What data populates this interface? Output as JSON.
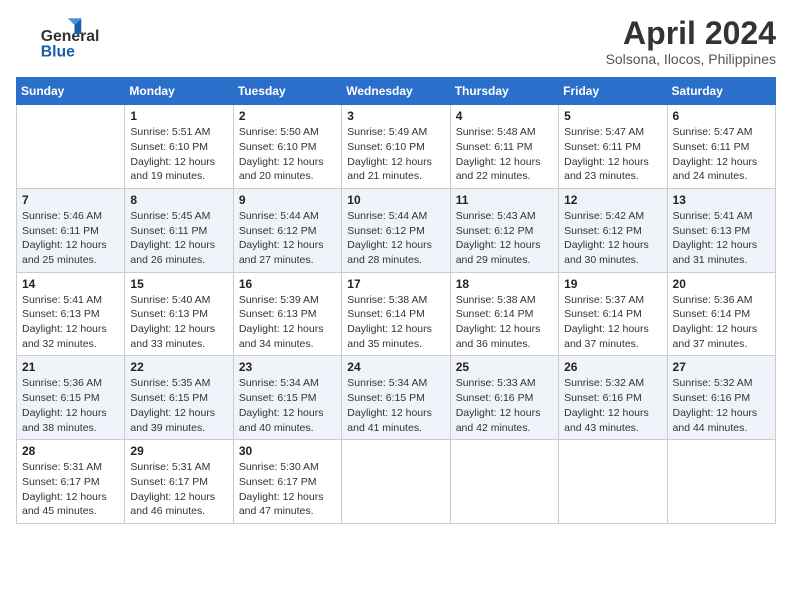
{
  "header": {
    "logo_line1": "General",
    "logo_line2": "Blue",
    "month_year": "April 2024",
    "location": "Solsona, Ilocos, Philippines"
  },
  "days_of_week": [
    "Sunday",
    "Monday",
    "Tuesday",
    "Wednesday",
    "Thursday",
    "Friday",
    "Saturday"
  ],
  "weeks": [
    [
      {
        "day": "",
        "info": ""
      },
      {
        "day": "1",
        "info": "Sunrise: 5:51 AM\nSunset: 6:10 PM\nDaylight: 12 hours\nand 19 minutes."
      },
      {
        "day": "2",
        "info": "Sunrise: 5:50 AM\nSunset: 6:10 PM\nDaylight: 12 hours\nand 20 minutes."
      },
      {
        "day": "3",
        "info": "Sunrise: 5:49 AM\nSunset: 6:10 PM\nDaylight: 12 hours\nand 21 minutes."
      },
      {
        "day": "4",
        "info": "Sunrise: 5:48 AM\nSunset: 6:11 PM\nDaylight: 12 hours\nand 22 minutes."
      },
      {
        "day": "5",
        "info": "Sunrise: 5:47 AM\nSunset: 6:11 PM\nDaylight: 12 hours\nand 23 minutes."
      },
      {
        "day": "6",
        "info": "Sunrise: 5:47 AM\nSunset: 6:11 PM\nDaylight: 12 hours\nand 24 minutes."
      }
    ],
    [
      {
        "day": "7",
        "info": "Sunrise: 5:46 AM\nSunset: 6:11 PM\nDaylight: 12 hours\nand 25 minutes."
      },
      {
        "day": "8",
        "info": "Sunrise: 5:45 AM\nSunset: 6:11 PM\nDaylight: 12 hours\nand 26 minutes."
      },
      {
        "day": "9",
        "info": "Sunrise: 5:44 AM\nSunset: 6:12 PM\nDaylight: 12 hours\nand 27 minutes."
      },
      {
        "day": "10",
        "info": "Sunrise: 5:44 AM\nSunset: 6:12 PM\nDaylight: 12 hours\nand 28 minutes."
      },
      {
        "day": "11",
        "info": "Sunrise: 5:43 AM\nSunset: 6:12 PM\nDaylight: 12 hours\nand 29 minutes."
      },
      {
        "day": "12",
        "info": "Sunrise: 5:42 AM\nSunset: 6:12 PM\nDaylight: 12 hours\nand 30 minutes."
      },
      {
        "day": "13",
        "info": "Sunrise: 5:41 AM\nSunset: 6:13 PM\nDaylight: 12 hours\nand 31 minutes."
      }
    ],
    [
      {
        "day": "14",
        "info": "Sunrise: 5:41 AM\nSunset: 6:13 PM\nDaylight: 12 hours\nand 32 minutes."
      },
      {
        "day": "15",
        "info": "Sunrise: 5:40 AM\nSunset: 6:13 PM\nDaylight: 12 hours\nand 33 minutes."
      },
      {
        "day": "16",
        "info": "Sunrise: 5:39 AM\nSunset: 6:13 PM\nDaylight: 12 hours\nand 34 minutes."
      },
      {
        "day": "17",
        "info": "Sunrise: 5:38 AM\nSunset: 6:14 PM\nDaylight: 12 hours\nand 35 minutes."
      },
      {
        "day": "18",
        "info": "Sunrise: 5:38 AM\nSunset: 6:14 PM\nDaylight: 12 hours\nand 36 minutes."
      },
      {
        "day": "19",
        "info": "Sunrise: 5:37 AM\nSunset: 6:14 PM\nDaylight: 12 hours\nand 37 minutes."
      },
      {
        "day": "20",
        "info": "Sunrise: 5:36 AM\nSunset: 6:14 PM\nDaylight: 12 hours\nand 37 minutes."
      }
    ],
    [
      {
        "day": "21",
        "info": "Sunrise: 5:36 AM\nSunset: 6:15 PM\nDaylight: 12 hours\nand 38 minutes."
      },
      {
        "day": "22",
        "info": "Sunrise: 5:35 AM\nSunset: 6:15 PM\nDaylight: 12 hours\nand 39 minutes."
      },
      {
        "day": "23",
        "info": "Sunrise: 5:34 AM\nSunset: 6:15 PM\nDaylight: 12 hours\nand 40 minutes."
      },
      {
        "day": "24",
        "info": "Sunrise: 5:34 AM\nSunset: 6:15 PM\nDaylight: 12 hours\nand 41 minutes."
      },
      {
        "day": "25",
        "info": "Sunrise: 5:33 AM\nSunset: 6:16 PM\nDaylight: 12 hours\nand 42 minutes."
      },
      {
        "day": "26",
        "info": "Sunrise: 5:32 AM\nSunset: 6:16 PM\nDaylight: 12 hours\nand 43 minutes."
      },
      {
        "day": "27",
        "info": "Sunrise: 5:32 AM\nSunset: 6:16 PM\nDaylight: 12 hours\nand 44 minutes."
      }
    ],
    [
      {
        "day": "28",
        "info": "Sunrise: 5:31 AM\nSunset: 6:17 PM\nDaylight: 12 hours\nand 45 minutes."
      },
      {
        "day": "29",
        "info": "Sunrise: 5:31 AM\nSunset: 6:17 PM\nDaylight: 12 hours\nand 46 minutes."
      },
      {
        "day": "30",
        "info": "Sunrise: 5:30 AM\nSunset: 6:17 PM\nDaylight: 12 hours\nand 47 minutes."
      },
      {
        "day": "",
        "info": ""
      },
      {
        "day": "",
        "info": ""
      },
      {
        "day": "",
        "info": ""
      },
      {
        "day": "",
        "info": ""
      }
    ]
  ]
}
